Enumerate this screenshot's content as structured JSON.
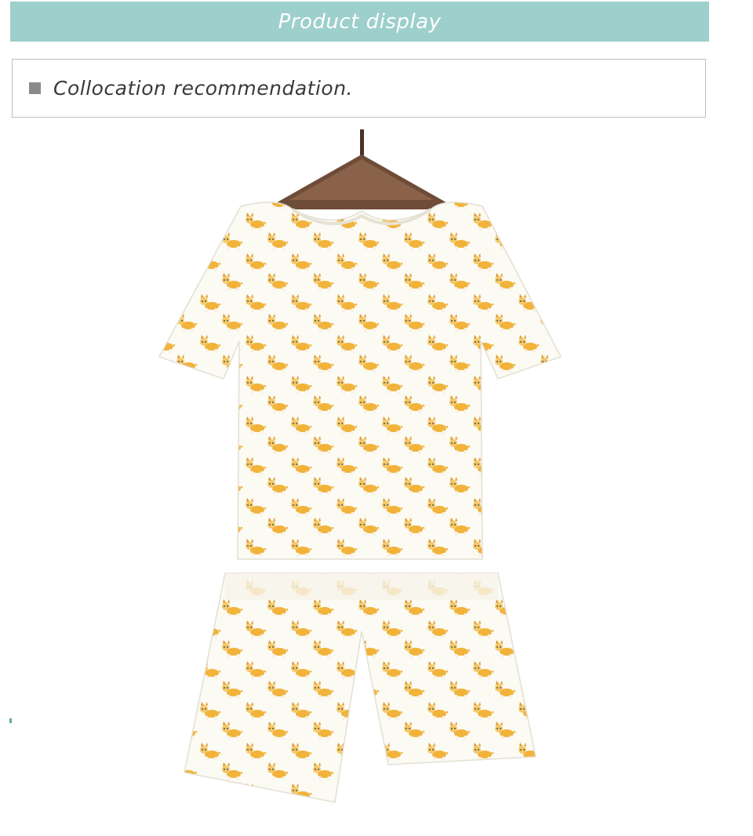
{
  "banner": {
    "title": "Product display"
  },
  "section": {
    "title": "Collocation recommendation."
  },
  "product_image": {
    "subject": "corgi-print-pajama-set",
    "hanger": "wooden-hanger-icon"
  },
  "colors": {
    "banner_bg": "#9dcfcc",
    "garment_bg": "#fbfaf3",
    "corgi_orange": "#f2b33b",
    "hanger_wood": "#6e4c38"
  }
}
